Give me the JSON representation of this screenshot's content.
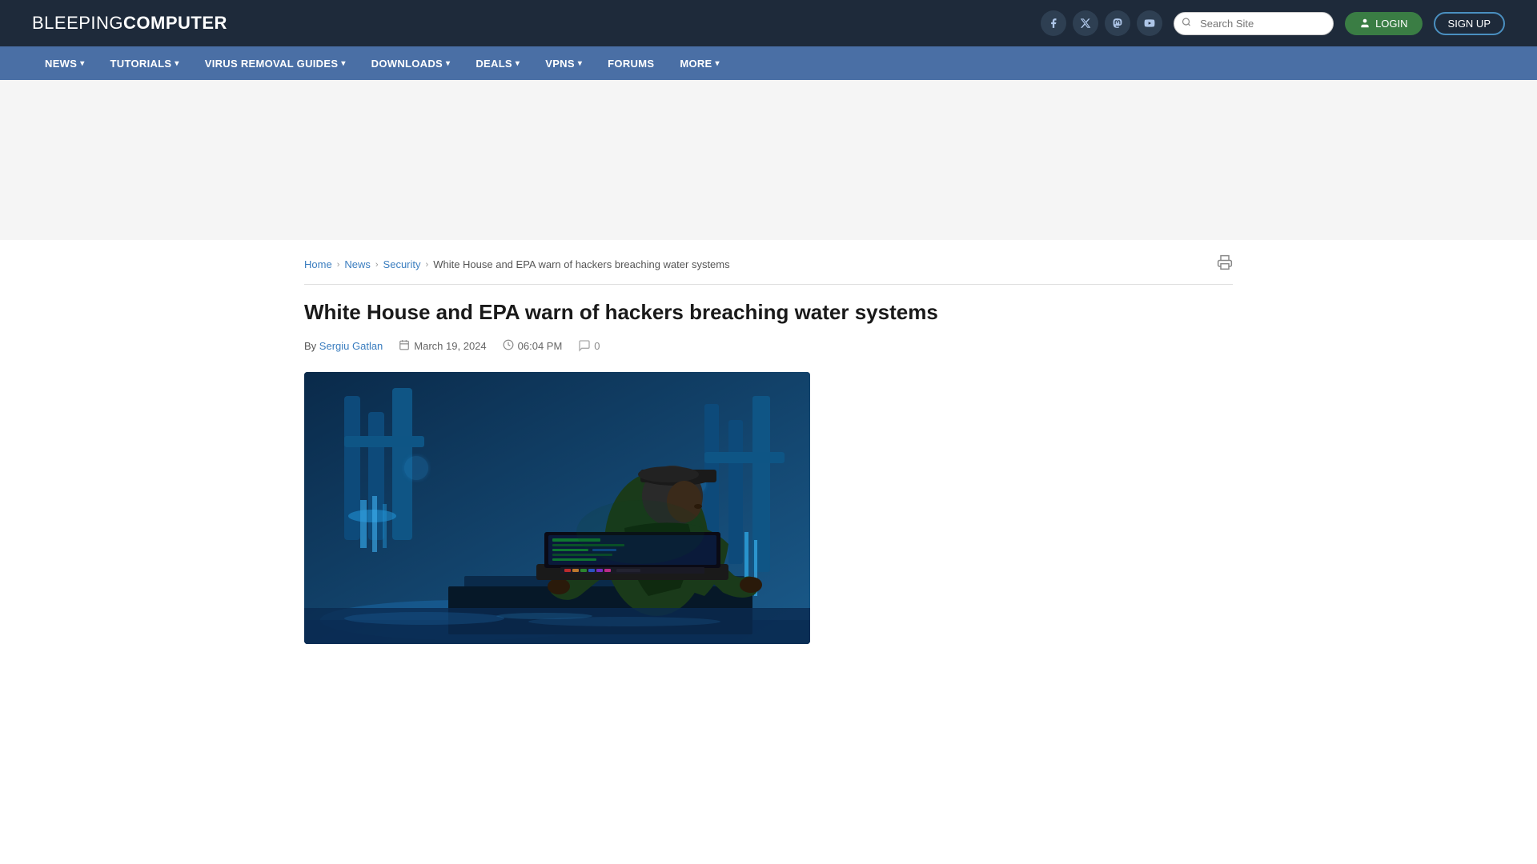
{
  "site": {
    "logo_first": "BLEEPING",
    "logo_second": "COMPUTER"
  },
  "header": {
    "search_placeholder": "Search Site",
    "login_label": "LOGIN",
    "signup_label": "SIGN UP",
    "social": [
      {
        "name": "facebook",
        "icon": "f"
      },
      {
        "name": "twitter",
        "icon": "𝕏"
      },
      {
        "name": "mastodon",
        "icon": "m"
      },
      {
        "name": "youtube",
        "icon": "▶"
      }
    ]
  },
  "nav": {
    "items": [
      {
        "label": "NEWS",
        "has_dropdown": true
      },
      {
        "label": "TUTORIALS",
        "has_dropdown": true
      },
      {
        "label": "VIRUS REMOVAL GUIDES",
        "has_dropdown": true
      },
      {
        "label": "DOWNLOADS",
        "has_dropdown": true
      },
      {
        "label": "DEALS",
        "has_dropdown": true
      },
      {
        "label": "VPNS",
        "has_dropdown": true
      },
      {
        "label": "FORUMS",
        "has_dropdown": false
      },
      {
        "label": "MORE",
        "has_dropdown": true
      }
    ]
  },
  "breadcrumb": {
    "items": [
      {
        "label": "Home",
        "link": true
      },
      {
        "label": "News",
        "link": true
      },
      {
        "label": "Security",
        "link": true
      },
      {
        "label": "White House and EPA warn of hackers breaching water systems",
        "link": false
      }
    ]
  },
  "article": {
    "title": "White House and EPA warn of hackers breaching water systems",
    "author": "Sergiu Gatlan",
    "date": "March 19, 2024",
    "time": "06:04 PM",
    "comments": "0",
    "image_alt": "Hacker at water treatment facility with laptop"
  }
}
